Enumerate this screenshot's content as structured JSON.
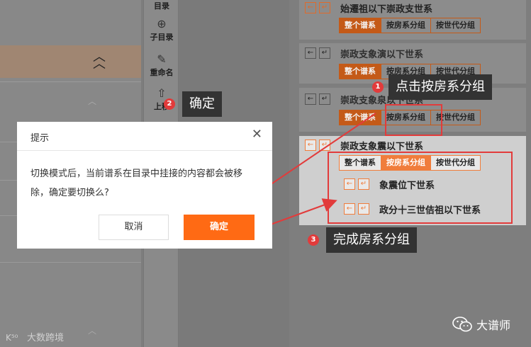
{
  "toolbar": {
    "catalog_label": "目录",
    "subcatalog_label": "子目录",
    "rename_label": "重命名",
    "moveup_label": "上移"
  },
  "groups": [
    {
      "title": "始遷祖以下崇政支世系",
      "segments": [
        "整个谱系",
        "按房系分组",
        "按世代分组"
      ],
      "active": 0
    },
    {
      "title": "崇政支象演以下世系",
      "segments": [
        "整个谱系",
        "按房系分组",
        "按世代分组"
      ],
      "active": 0
    },
    {
      "title": "崇政支象泉以下世系",
      "segments": [
        "整个谱系",
        "按房系分组",
        "按世代分组"
      ],
      "active": 0
    },
    {
      "title": "崇政支象震以下世系",
      "segments": [
        "整个谱系",
        "按房系分组",
        "按世代分组"
      ],
      "active": 1,
      "children": [
        "象震位下世系",
        "政分十三世佶祖以下世系"
      ]
    }
  ],
  "callouts": {
    "step1": {
      "num": "1",
      "text": "点击按房系分组"
    },
    "step2": {
      "num": "2",
      "text": "确定"
    },
    "step3": {
      "num": "3",
      "text": "完成房系分组"
    }
  },
  "dialog": {
    "title": "提示",
    "message": "切换模式后，当前谱系在目录中挂接的内容都会被移除，确定要切换么?",
    "cancel_label": "取消",
    "ok_label": "确定"
  },
  "watermark": {
    "left": "大数跨境",
    "brand": "大谱师"
  },
  "colors": {
    "accent": "#ff6a14",
    "highlight_red": "#e23b3b",
    "callout_bg": "#333333"
  }
}
